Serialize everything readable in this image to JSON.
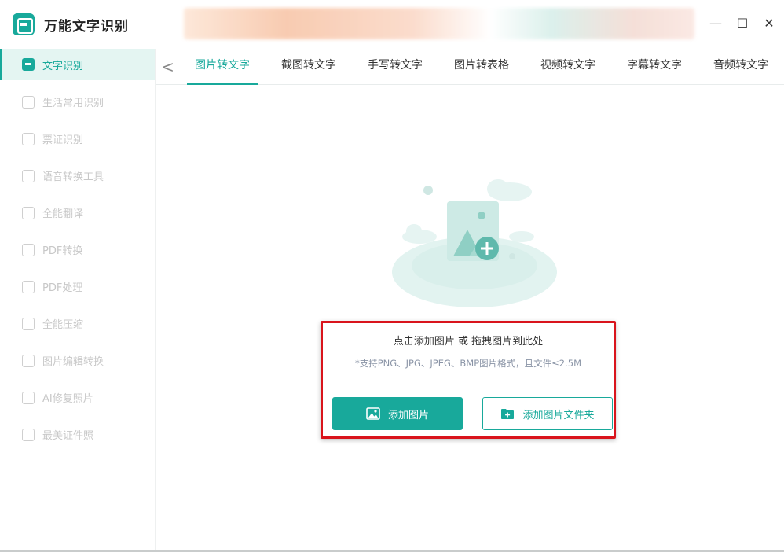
{
  "app": {
    "title": "万能文字识别"
  },
  "window": {
    "minimize": "—",
    "maximize": "☐",
    "close": "✕"
  },
  "sidebar": {
    "items": [
      {
        "label": "文字识别",
        "active": true
      },
      {
        "label": "生活常用识别"
      },
      {
        "label": "票证识别"
      },
      {
        "label": "语音转换工具"
      },
      {
        "label": "全能翻译"
      },
      {
        "label": "PDF转换"
      },
      {
        "label": "PDF处理"
      },
      {
        "label": "全能压缩"
      },
      {
        "label": "图片编辑转换"
      },
      {
        "label": "AI修复照片"
      },
      {
        "label": "最美证件照"
      }
    ]
  },
  "tabs": {
    "back": "<",
    "items": [
      {
        "label": "图片转文字",
        "active": true
      },
      {
        "label": "截图转文字"
      },
      {
        "label": "手写转文字"
      },
      {
        "label": "图片转表格"
      },
      {
        "label": "视频转文字"
      },
      {
        "label": "字幕转文字"
      },
      {
        "label": "音频转文字"
      }
    ]
  },
  "upload": {
    "hint": "点击添加图片 或 拖拽图片到此处",
    "formats": "*支持PNG、JPG、JPEG、BMP图片格式，且文件≤2.5M",
    "add_image": "添加图片",
    "add_folder": "添加图片文件夹"
  },
  "colors": {
    "accent": "#18a99b",
    "highlight": "#d9141c"
  }
}
